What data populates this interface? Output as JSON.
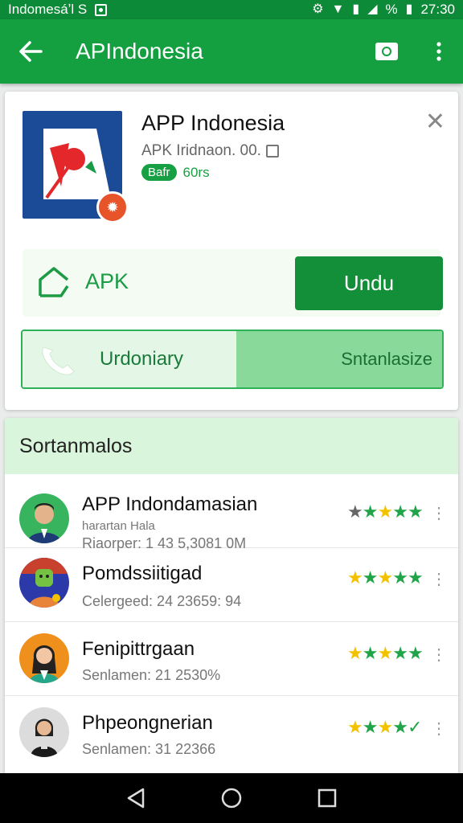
{
  "status_bar": {
    "carrier": "Indomesáʼl S",
    "percent": "%",
    "time": "27:30"
  },
  "app_bar": {
    "title": "APIndonesia",
    "back_icon": "back-arrow-icon",
    "camera_icon": "camera-icon",
    "more_icon": "more-vert-icon"
  },
  "app_card": {
    "name": "APP Indonesia",
    "subtitle": "APK Iridnaon. 00.",
    "tag": "Bafr",
    "tag_extra": "60rs",
    "apk_label": "APK",
    "download_label": "Undu",
    "segment_left": "Urdoniary",
    "segment_right": "Sntanlasize"
  },
  "list_section": {
    "header": "Sortanmalos",
    "items": [
      {
        "title": "APP Indondamasian",
        "subtitle": "harartan Hala",
        "meta": "Riaorper: 1 43 5,3081 0M",
        "rating": 5
      },
      {
        "title": "Pomdssiitigad",
        "subtitle": "",
        "meta": "Celergeed: 24 23659: 94",
        "rating": 5
      },
      {
        "title": "Fenipittrgaan",
        "subtitle": "",
        "meta": "Senlamen: 21 2530%",
        "rating": 5
      },
      {
        "title": "Phpeongnerian",
        "subtitle": "",
        "meta": "Senlamen: 31 22366",
        "rating": 4
      }
    ]
  },
  "colors": {
    "primary": "#14a040",
    "primary_dark": "#0d8a38",
    "download": "#138f39",
    "star_gold": "#f2c200",
    "star_green": "#1fa547"
  }
}
